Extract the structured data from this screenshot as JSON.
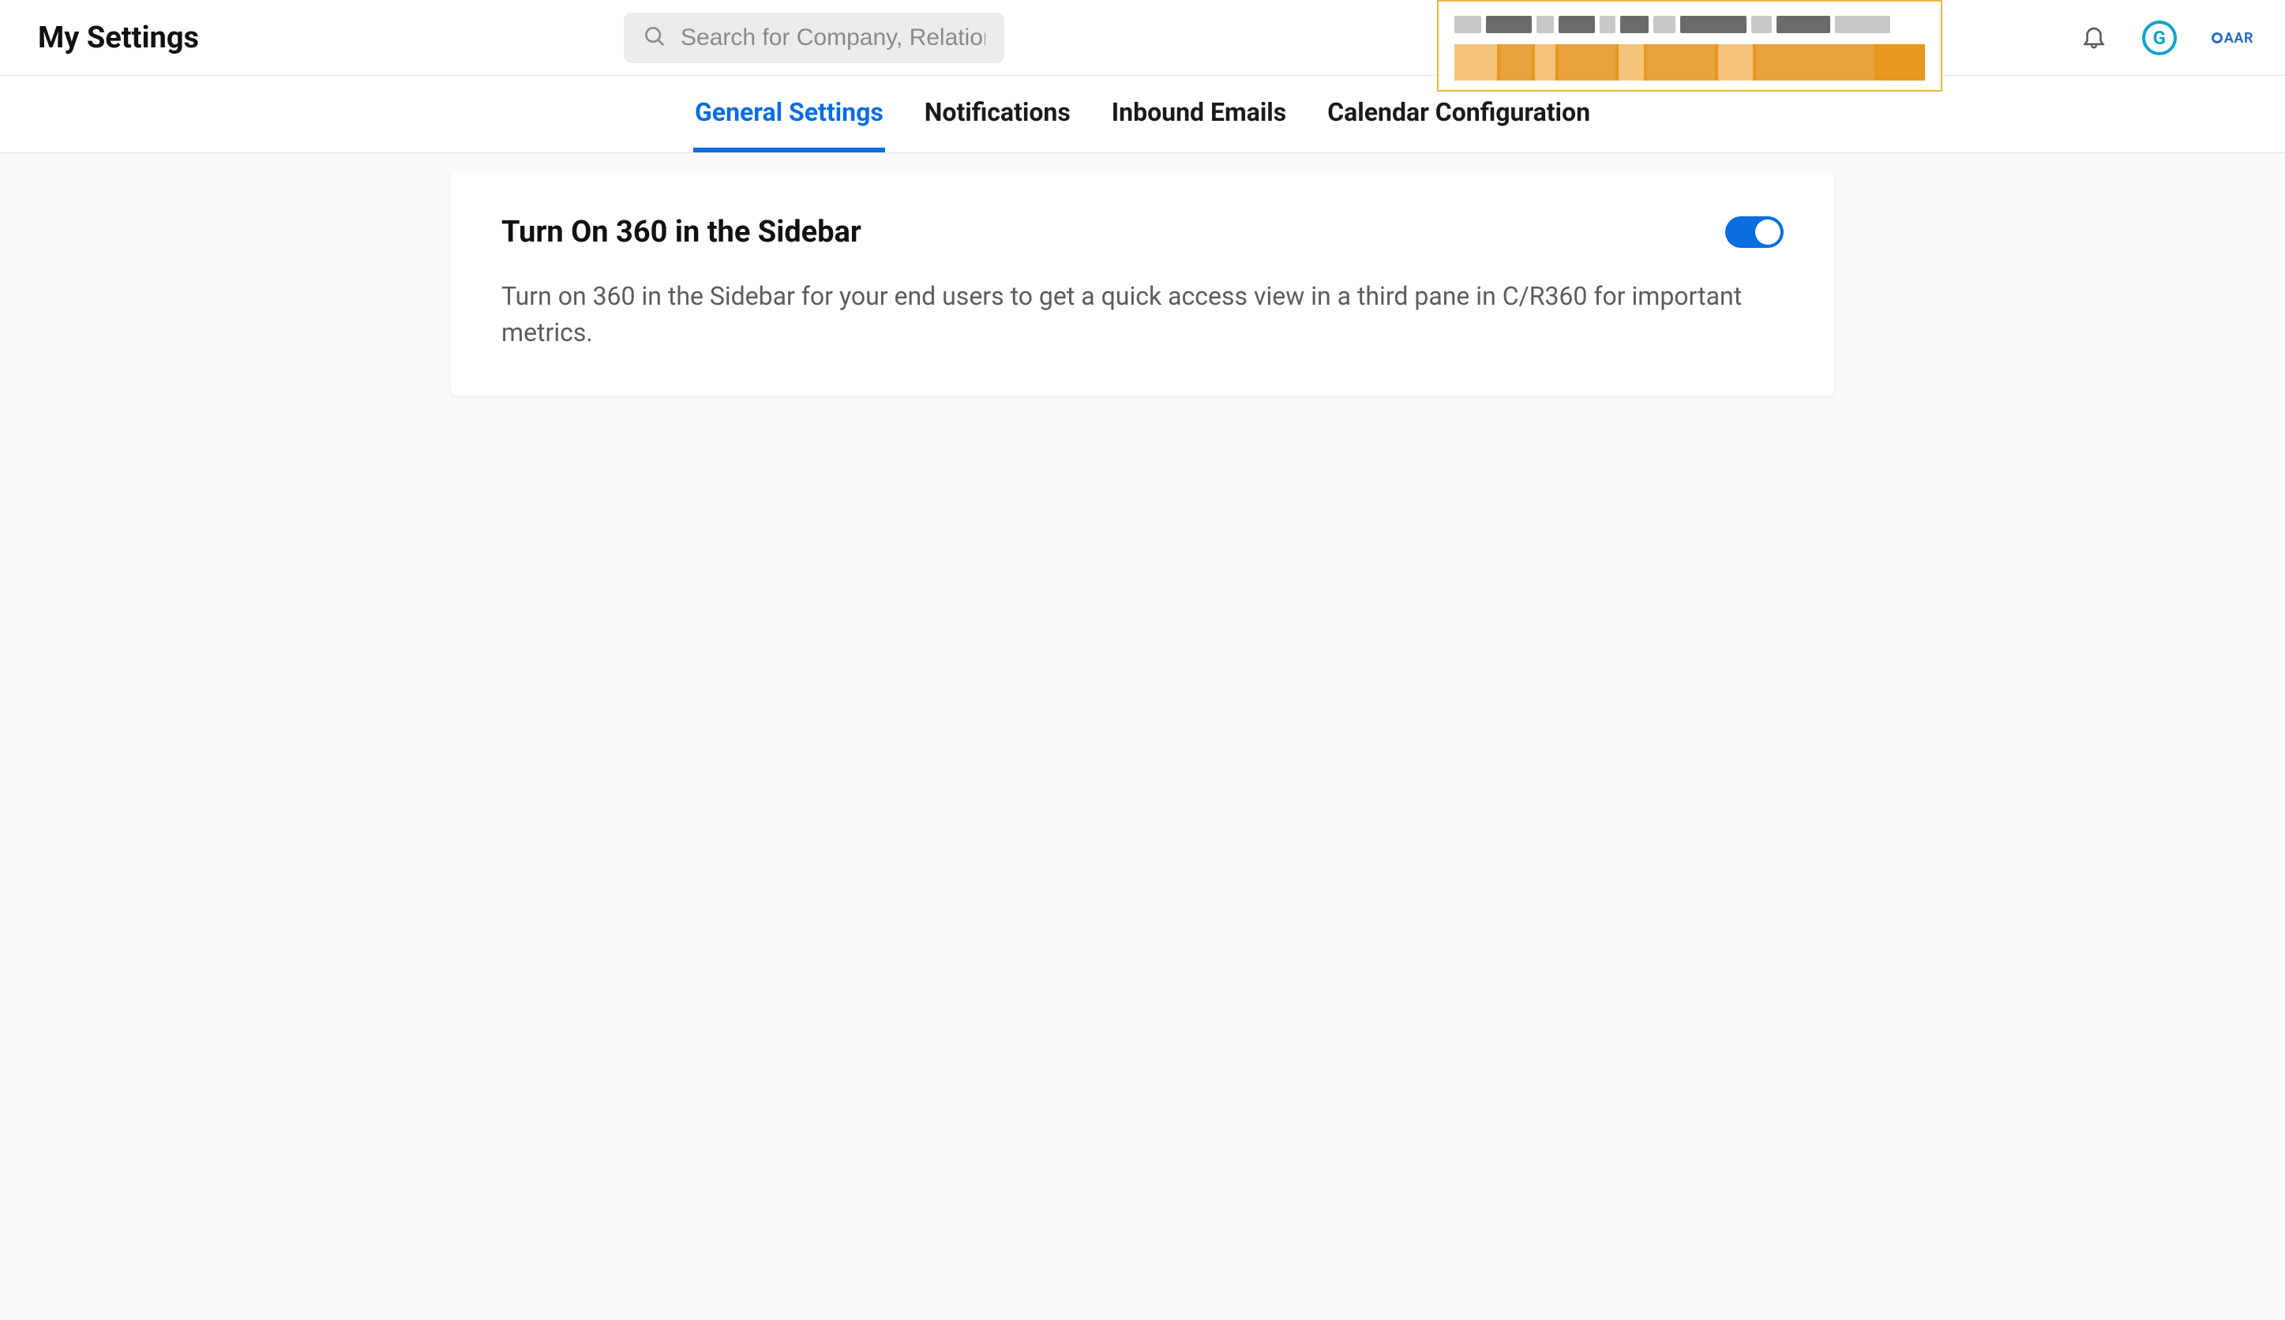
{
  "header": {
    "title": "My Settings",
    "search_placeholder": "Search for Company, Relationship, or Person",
    "avatar_initial": "G",
    "brand_text": "AAR"
  },
  "tabs": [
    {
      "label": "General Settings",
      "active": true
    },
    {
      "label": "Notifications",
      "active": false
    },
    {
      "label": "Inbound Emails",
      "active": false
    },
    {
      "label": "Calendar Configuration",
      "active": false
    }
  ],
  "card": {
    "title": "Turn On 360 in the Sidebar",
    "description": "Turn on 360 in the Sidebar for your end users to get a quick access view in a third pane in C/R360 for important metrics.",
    "toggle_on": true
  },
  "colors": {
    "accent": "#0a6de0",
    "avatar_ring": "#0ea4c9",
    "brand": "#2d6cc0"
  }
}
